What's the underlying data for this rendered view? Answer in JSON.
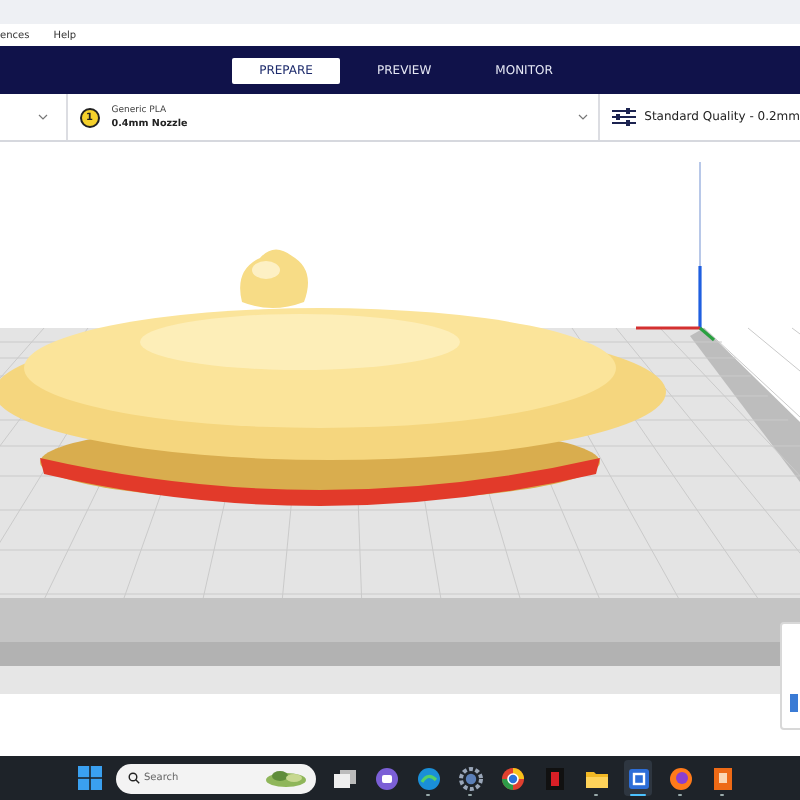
{
  "menu_bar": {
    "items": [
      "ences",
      "Help"
    ]
  },
  "header": {
    "tabs": [
      {
        "label": "PREPARE",
        "selected": true
      },
      {
        "label": "PREVIEW",
        "selected": false
      },
      {
        "label": "MONITOR",
        "selected": false
      }
    ]
  },
  "toolbar": {
    "extruder_number": "1",
    "material": "Generic PLA",
    "nozzle": "0.4mm Nozzle",
    "quality": "Standard Quality - 0.2mm"
  },
  "taskbar": {
    "search": {
      "placeholder": "Search"
    },
    "apps": [
      {
        "kind": "squares",
        "running": false,
        "active": false
      },
      {
        "kind": "chat",
        "running": false,
        "active": false
      },
      {
        "kind": "swirl",
        "running": true,
        "active": false
      },
      {
        "kind": "gear",
        "running": true,
        "active": false
      },
      {
        "kind": "ring",
        "running": false,
        "active": false
      },
      {
        "kind": "redtile",
        "running": false,
        "active": false
      },
      {
        "kind": "folder",
        "running": true,
        "active": false
      },
      {
        "kind": "cura",
        "running": true,
        "active": true
      },
      {
        "kind": "fox",
        "running": true,
        "active": false
      },
      {
        "kind": "orangetile",
        "running": true,
        "active": false
      }
    ]
  }
}
